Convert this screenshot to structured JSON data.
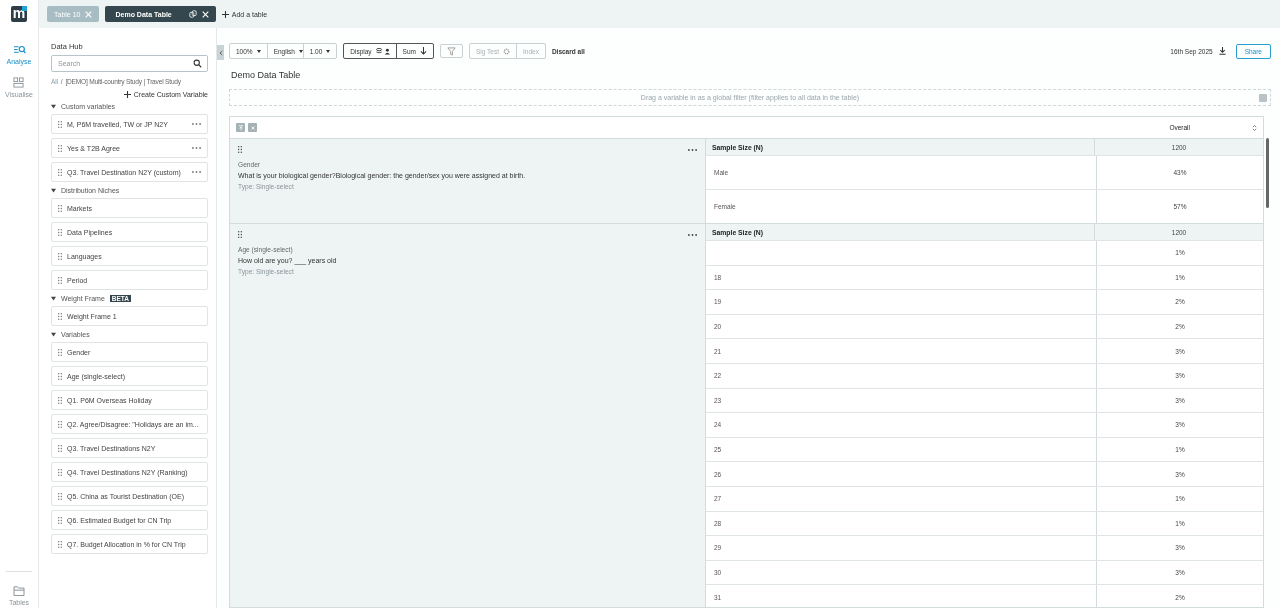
{
  "logo": "m",
  "app_tabs": [
    {
      "label": "Table 10",
      "selected": false
    },
    {
      "label": "Demo Data Table",
      "selected": true
    }
  ],
  "add_table": "Add a table",
  "nav": [
    {
      "label": "Analyse",
      "selected": true
    },
    {
      "label": "Visualise",
      "selected": false
    }
  ],
  "nav_bottom": "Tables",
  "data_hub": {
    "title": "Data Hub",
    "search_placeholder": "Search",
    "breadcrumb": [
      "All",
      "[DEMO] Multi-country Study | Travel Study"
    ],
    "breadcrumb_separator": "/",
    "create": "Create Custom Variable",
    "groups": [
      {
        "title": "Custom variables",
        "expanded": true,
        "items": [
          {
            "label": "M, P6M travelled, TW or JP N2Y",
            "menu": true
          },
          {
            "label": "Yes & T2B Agree",
            "menu": true
          },
          {
            "label": "Q3. Travel Destination N2Y (custom)",
            "menu": true
          }
        ]
      },
      {
        "title": "Distribution Niches",
        "expanded": true,
        "items": [
          {
            "label": "Markets",
            "menu": false
          },
          {
            "label": "Data Pipelines",
            "menu": false
          },
          {
            "label": "Languages",
            "menu": false
          },
          {
            "label": "Period",
            "menu": false
          }
        ]
      },
      {
        "title": "Weight Frame",
        "badge": "BETA",
        "expanded": true,
        "items": [
          {
            "label": "Weight Frame 1",
            "menu": false
          }
        ]
      },
      {
        "title": "Variables",
        "expanded": true,
        "items": [
          {
            "label": "Gender",
            "menu": false
          },
          {
            "label": "Age (single-select)",
            "menu": false
          },
          {
            "label": "Q1. P6M Overseas Holiday",
            "menu": false
          },
          {
            "label": "Q2. Agree/Disagree: \"Holidays are an im...",
            "menu": false
          },
          {
            "label": "Q3. Travel Destinations N2Y",
            "menu": false
          },
          {
            "label": "Q4. Travel Destinations N2Y (Ranking)",
            "menu": false
          },
          {
            "label": "Q5. China as Tourist Destination (OE)",
            "menu": false
          },
          {
            "label": "Q6. Estimated Budget for CN Trip",
            "menu": false
          },
          {
            "label": "Q7. Budget Allocation in % for CN Trip",
            "menu": false
          }
        ]
      }
    ]
  },
  "toolbar": {
    "zoom": "100%",
    "language": "English",
    "weight": "1.00",
    "display": "Display",
    "sum": "Sum",
    "sig_test": {
      "label": "Sig Test",
      "disabled": true
    },
    "index": {
      "label": "Index",
      "disabled": true
    },
    "discard": "Discard all",
    "date": "16th Sep 2025",
    "share": "Share"
  },
  "table_title": "Demo Data Table",
  "filter_hint": "Drag a variable in as a global filter (filter applies to all data in the table)",
  "table": {
    "column": "Overall",
    "blocks": [
      {
        "name": "Gender",
        "question": "What is your biological gender?Biological gender: the gender/sex you were assigned at birth.",
        "type": "Type: Single-select",
        "rows": [
          {
            "kind": "sample",
            "label": "Sample Size (N)",
            "value": "1200"
          },
          {
            "kind": "value",
            "label": "Male",
            "value": "43%"
          },
          {
            "kind": "value",
            "label": "Female",
            "value": "57%"
          }
        ]
      },
      {
        "name": "Age (single-select)",
        "question": "How old are you? ___ years old",
        "type": "Type: Single-select",
        "rows": [
          {
            "kind": "sample",
            "label": "Sample Size (N)",
            "value": "1200"
          },
          {
            "kind": "value",
            "value": "1%"
          },
          {
            "kind": "value",
            "label": "18",
            "value": "1%"
          },
          {
            "kind": "value",
            "label": "19",
            "value": "2%"
          },
          {
            "kind": "value",
            "label": "20",
            "value": "2%"
          },
          {
            "kind": "value",
            "label": "21",
            "value": "3%"
          },
          {
            "kind": "value",
            "label": "22",
            "value": "3%"
          },
          {
            "kind": "value",
            "label": "23",
            "value": "3%"
          },
          {
            "kind": "value",
            "label": "24",
            "value": "3%"
          },
          {
            "kind": "value",
            "label": "25",
            "value": "1%"
          },
          {
            "kind": "value",
            "label": "26",
            "value": "3%"
          },
          {
            "kind": "value",
            "label": "27",
            "value": "1%"
          },
          {
            "kind": "value",
            "label": "28",
            "value": "1%"
          },
          {
            "kind": "value",
            "label": "29",
            "value": "3%"
          },
          {
            "kind": "value",
            "label": "30",
            "value": "3%"
          },
          {
            "kind": "value",
            "label": "31",
            "value": "2%"
          }
        ]
      }
    ]
  }
}
